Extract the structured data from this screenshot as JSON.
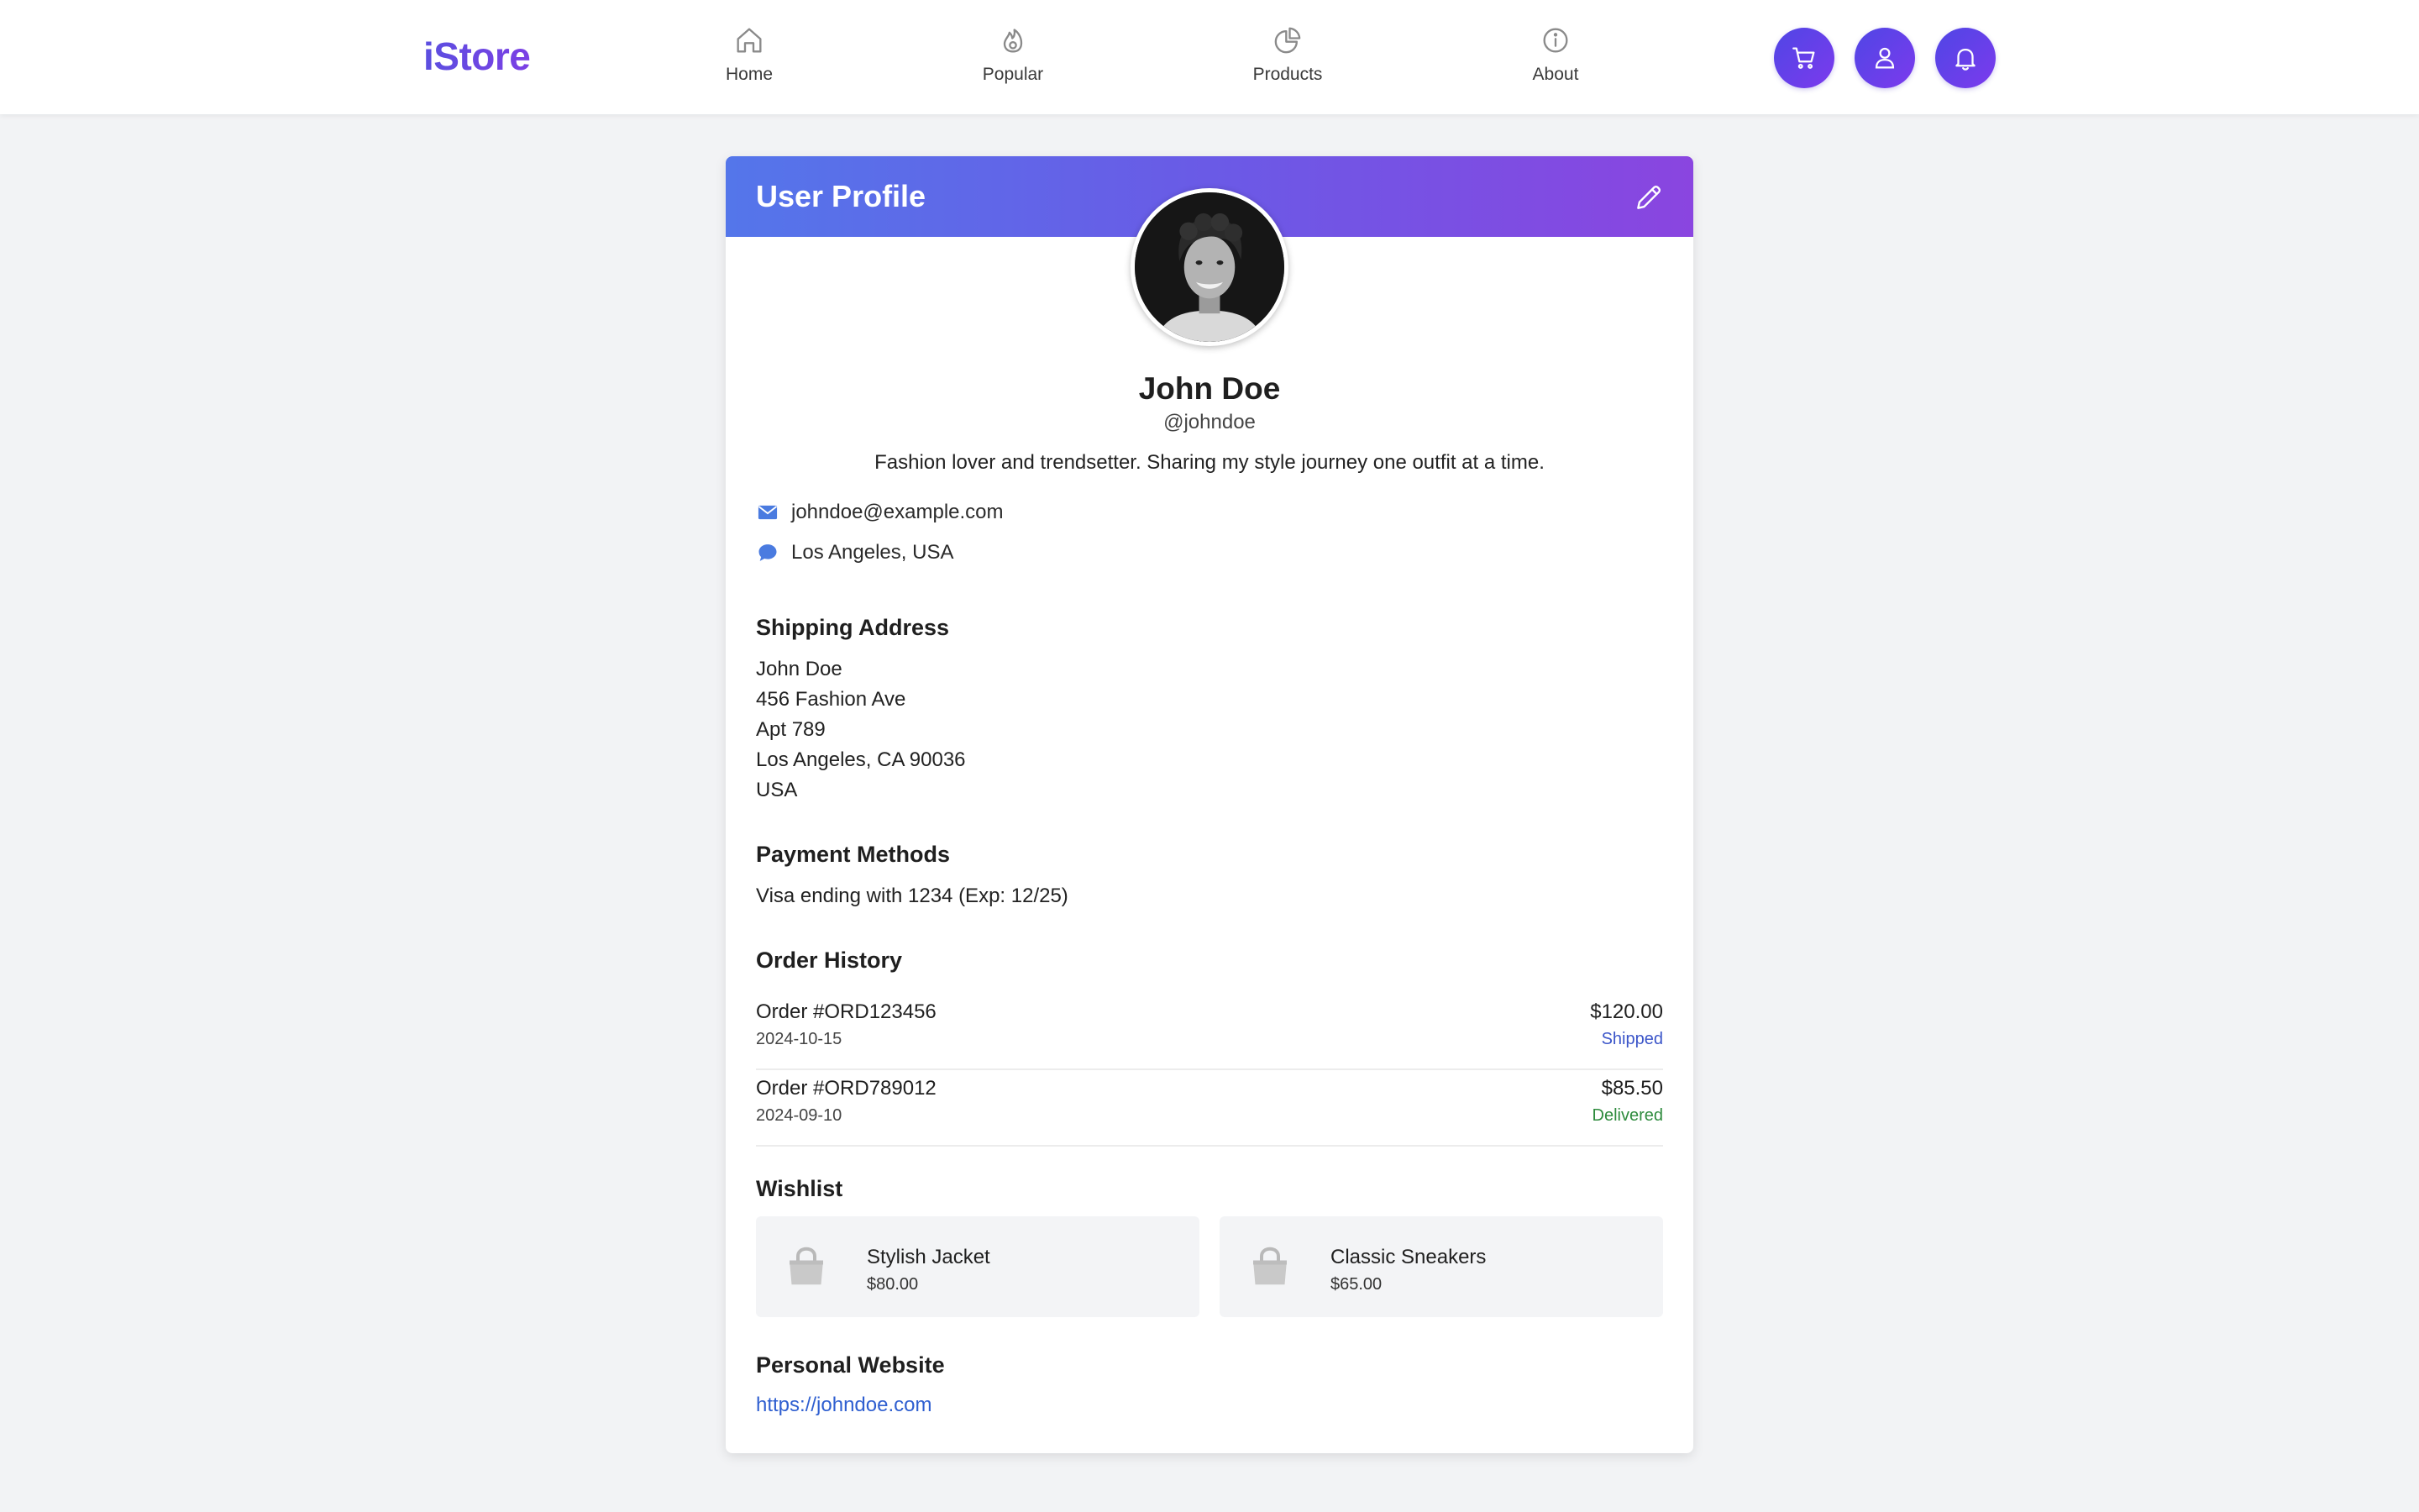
{
  "brand": {
    "logo_text": "iStore",
    "accent": "#5b4fe0",
    "accent_secondary": "#7c3aed"
  },
  "nav": {
    "items": [
      {
        "label": "Home",
        "icon": "home-icon"
      },
      {
        "label": "Popular",
        "icon": "flame-icon"
      },
      {
        "label": "Products",
        "icon": "pie-chart-icon"
      },
      {
        "label": "About",
        "icon": "info-icon"
      }
    ],
    "actions": [
      {
        "icon": "cart-icon"
      },
      {
        "icon": "user-icon"
      },
      {
        "icon": "bell-icon"
      }
    ]
  },
  "profile": {
    "header_title": "User Profile",
    "edit_icon": "pencil-icon",
    "name": "John Doe",
    "username": "@johndoe",
    "bio": "Fashion lover and trendsetter. Sharing my style journey one outfit at a time.",
    "email": "johndoe@example.com",
    "location": "Los Angeles, USA"
  },
  "shipping": {
    "title": "Shipping Address",
    "lines": [
      "John Doe",
      "456 Fashion Ave",
      "Apt 789",
      "Los Angeles, CA 90036",
      "USA"
    ]
  },
  "payment": {
    "title": "Payment Methods",
    "methods": [
      "Visa ending with 1234 (Exp: 12/25)"
    ]
  },
  "orders": {
    "title": "Order History",
    "items": [
      {
        "id": "Order #ORD123456",
        "date": "2024-10-15",
        "amount": "$120.00",
        "status": "Shipped",
        "status_color": "#3b55c9"
      },
      {
        "id": "Order #ORD789012",
        "date": "2024-09-10",
        "amount": "$85.50",
        "status": "Delivered",
        "status_color": "#2e8b3d"
      }
    ]
  },
  "wishlist": {
    "title": "Wishlist",
    "items": [
      {
        "name": "Stylish Jacket",
        "price": "$80.00",
        "icon": "shopping-bag-icon"
      },
      {
        "name": "Classic Sneakers",
        "price": "$65.00",
        "icon": "shopping-bag-icon"
      }
    ]
  },
  "website": {
    "title": "Personal Website",
    "url": "https://johndoe.com"
  }
}
